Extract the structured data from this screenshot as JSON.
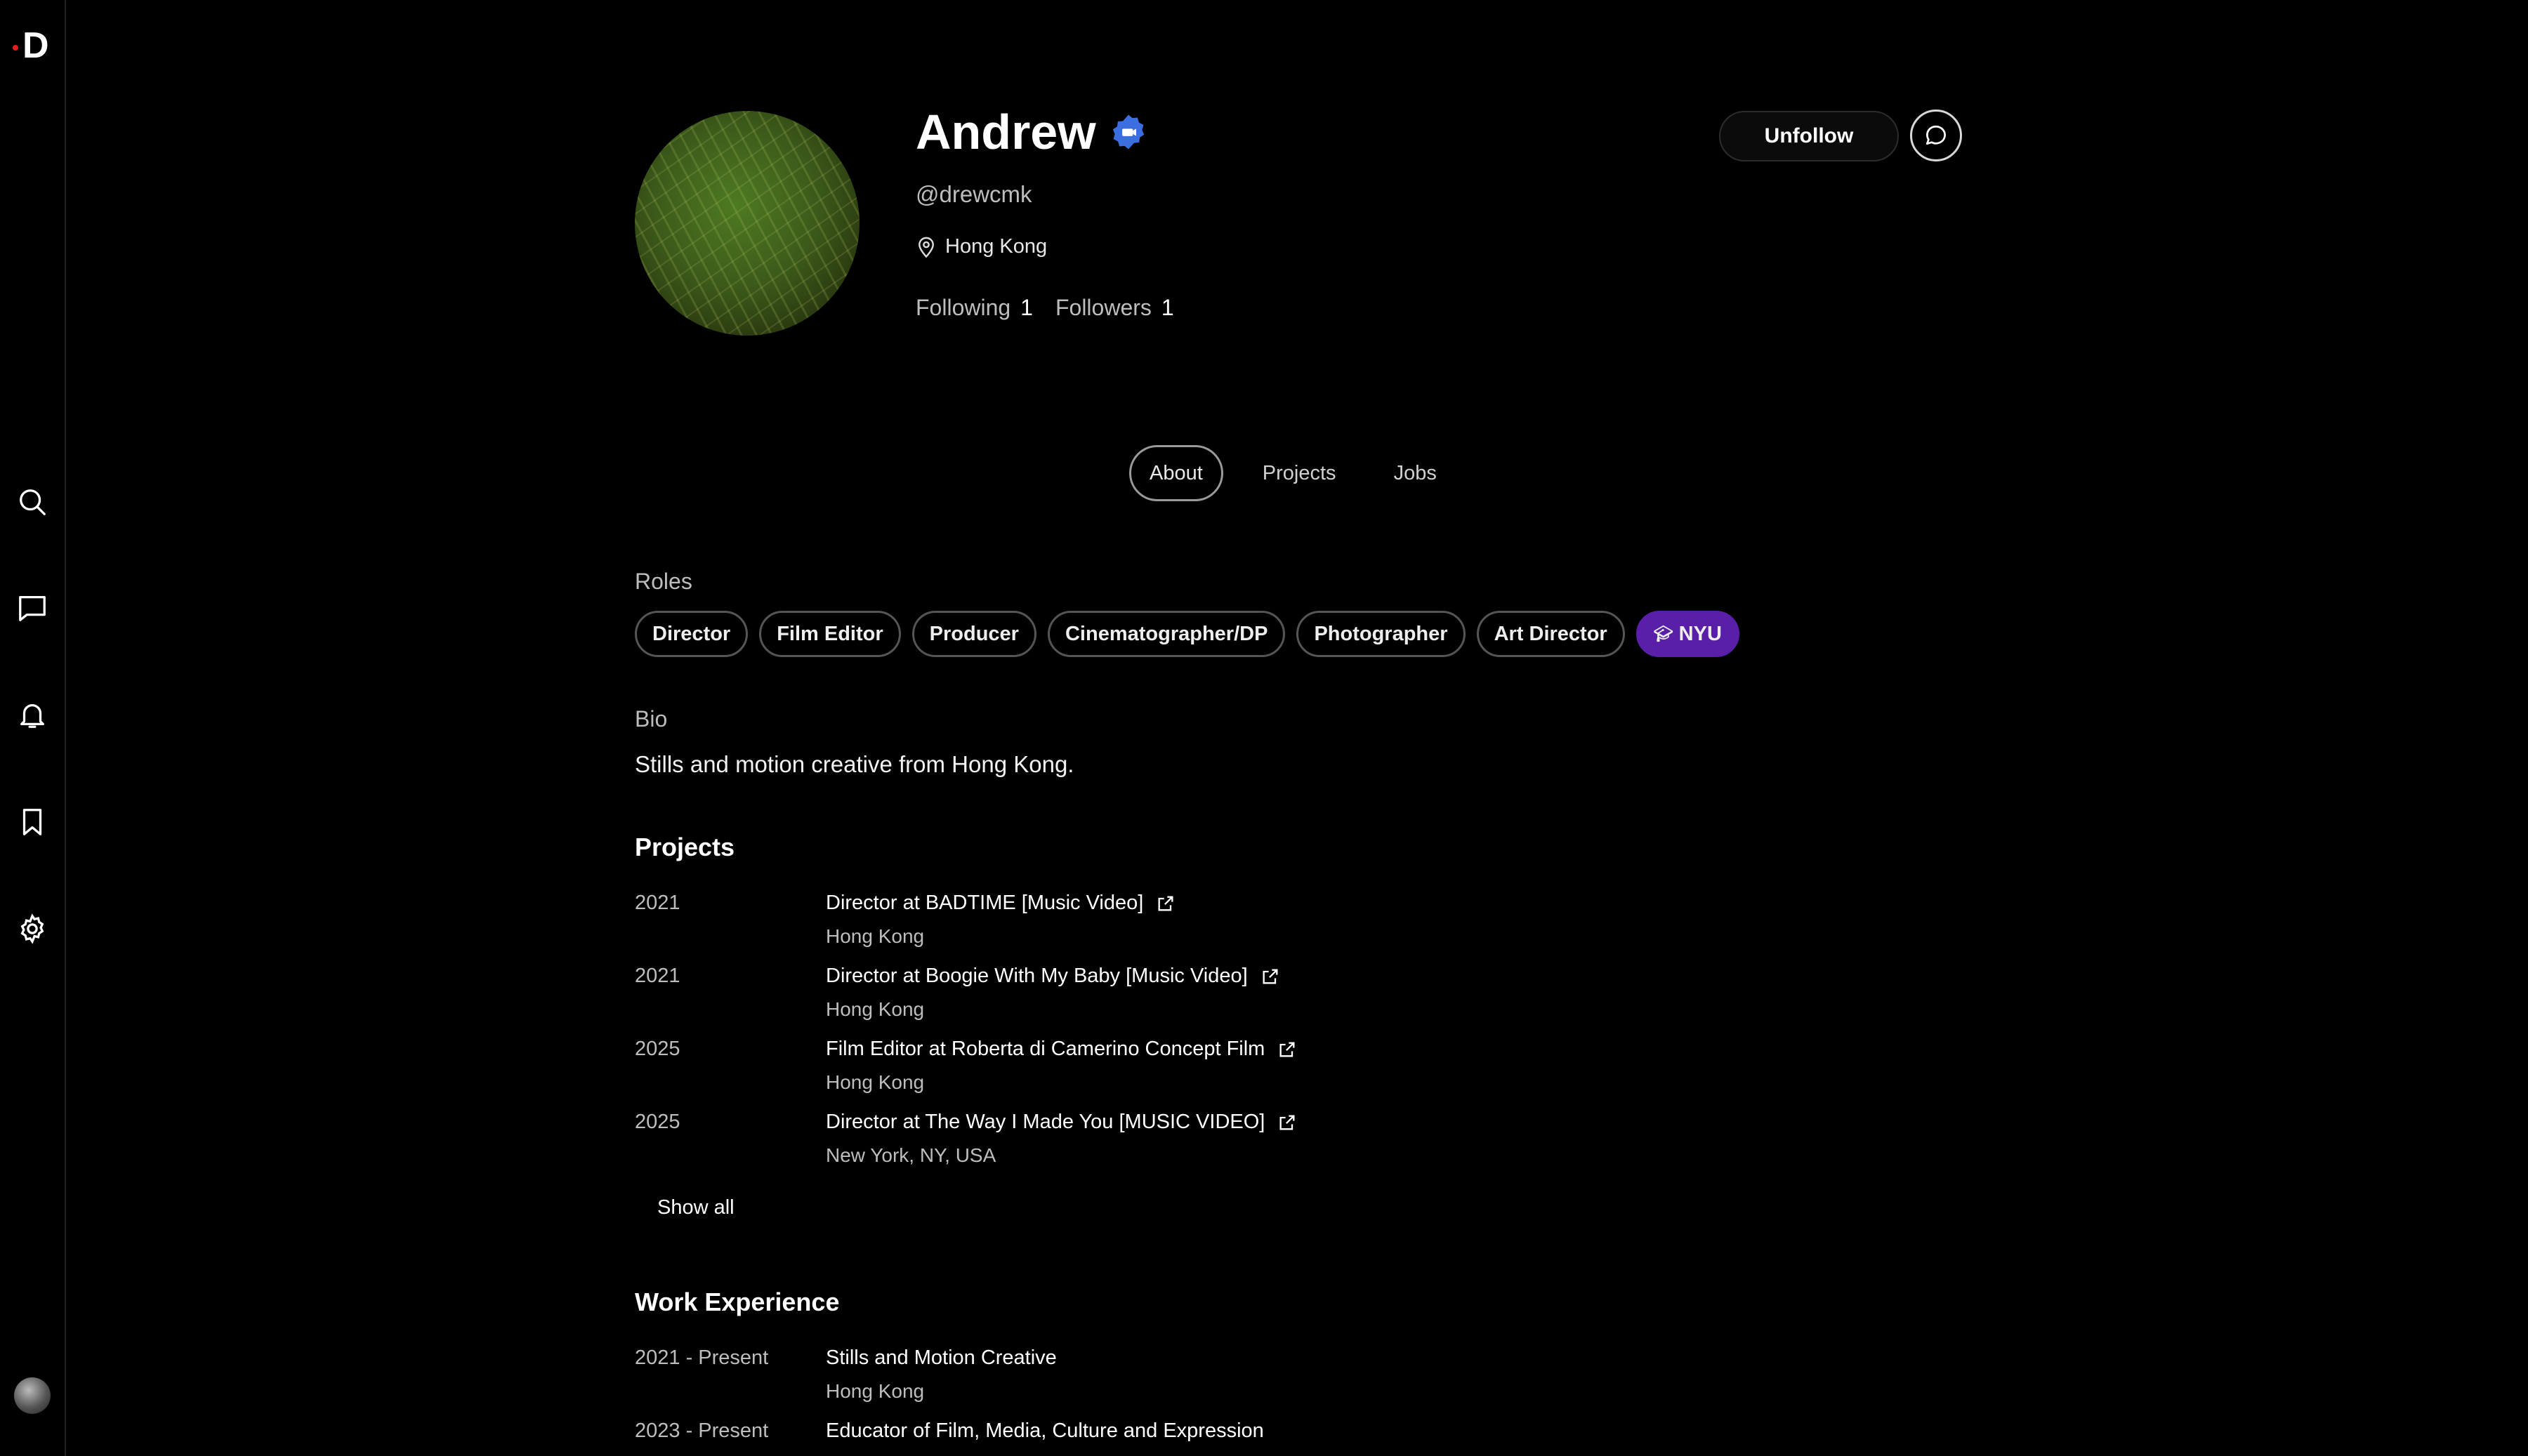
{
  "sidebar": {
    "logo_text": "D",
    "icons": [
      "search-icon",
      "messages-icon",
      "notifications-icon",
      "bookmark-icon",
      "settings-icon"
    ]
  },
  "profile": {
    "name": "Andrew",
    "verified": true,
    "handle": "@drewcmk",
    "location": "Hong Kong",
    "following_label": "Following",
    "following_count": "1",
    "followers_label": "Followers",
    "followers_count": "1",
    "unfollow_label": "Unfollow"
  },
  "tabs": [
    {
      "label": "About",
      "active": true
    },
    {
      "label": "Projects",
      "active": false
    },
    {
      "label": "Jobs",
      "active": false
    }
  ],
  "roles": {
    "label": "Roles",
    "items": [
      "Director",
      "Film Editor",
      "Producer",
      "Cinematographer/DP",
      "Photographer",
      "Art Director"
    ],
    "school": "NYU"
  },
  "bio": {
    "label": "Bio",
    "text": "Stills and motion creative from Hong Kong."
  },
  "projects": {
    "heading": "Projects",
    "items": [
      {
        "year": "2021",
        "title": "Director at BADTIME [Music Video]",
        "location": "Hong Kong"
      },
      {
        "year": "2021",
        "title": "Director at Boogie With My Baby [Music Video]",
        "location": "Hong Kong"
      },
      {
        "year": "2025",
        "title": "Film Editor at Roberta di Camerino Concept Film",
        "location": "Hong Kong"
      },
      {
        "year": "2025",
        "title": "Director at The Way I Made You [MUSIC VIDEO]",
        "location": "New York, NY, USA"
      }
    ],
    "show_all_label": "Show all"
  },
  "work_experience": {
    "heading": "Work Experience",
    "items": [
      {
        "period": "2021 - Present",
        "title": "Stills and Motion Creative",
        "location": "Hong Kong"
      },
      {
        "period": "2023 - Present",
        "title": "Educator of Film, Media, Culture and Expression",
        "location": ""
      }
    ]
  },
  "colors": {
    "background": "#000000",
    "verified_badge": "#3b6fe0",
    "school_chip": "#5a1fa8"
  }
}
